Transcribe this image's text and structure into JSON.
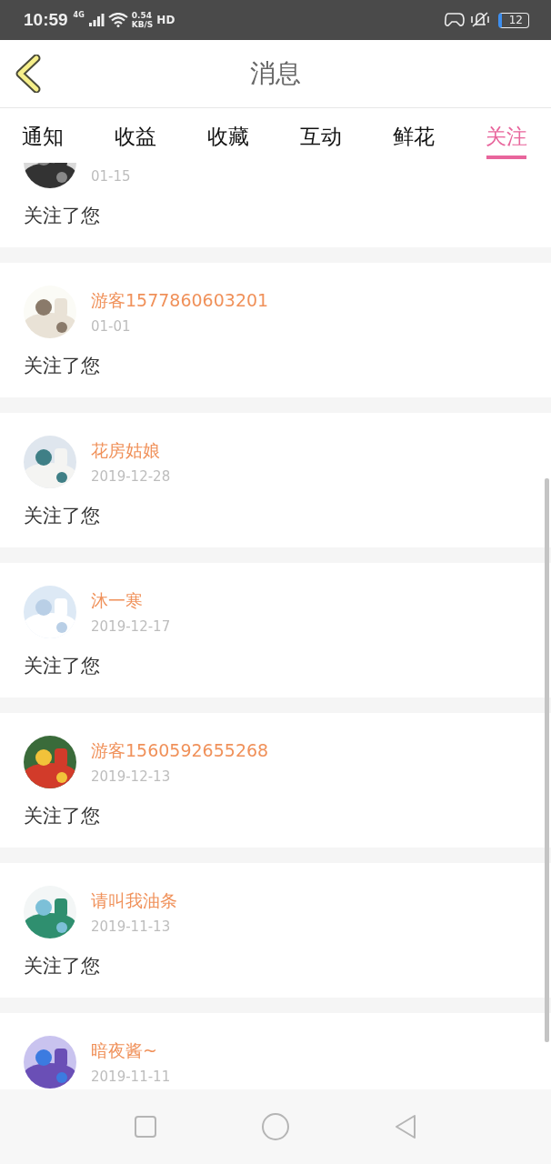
{
  "status_bar": {
    "time": "10:59",
    "network": "4G",
    "speed": "0.54",
    "speed_unit": "KB/S",
    "hd": "HD",
    "battery": "12"
  },
  "header": {
    "title": "消息"
  },
  "tabs": [
    {
      "label": "通知",
      "selected": false
    },
    {
      "label": "收益",
      "selected": false
    },
    {
      "label": "收藏",
      "selected": false
    },
    {
      "label": "互动",
      "selected": false
    },
    {
      "label": "鲜花",
      "selected": false
    },
    {
      "label": "关注",
      "selected": true
    }
  ],
  "messages": [
    {
      "date": "01-15",
      "text": "关注了您"
    },
    {
      "name": "游客1577860603201",
      "date": "01-01",
      "text": "关注了您"
    },
    {
      "name": "花房姑娘",
      "date": "2019-12-28",
      "text": "关注了您"
    },
    {
      "name": "沐一寒",
      "date": "2019-12-17",
      "text": "关注了您"
    },
    {
      "name": "游客1560592655268",
      "date": "2019-12-13",
      "text": "关注了您"
    },
    {
      "name": "请叫我油条",
      "date": "2019-11-13",
      "text": "关注了您"
    },
    {
      "name": "暗夜酱~",
      "date": "2019-11-11"
    }
  ]
}
